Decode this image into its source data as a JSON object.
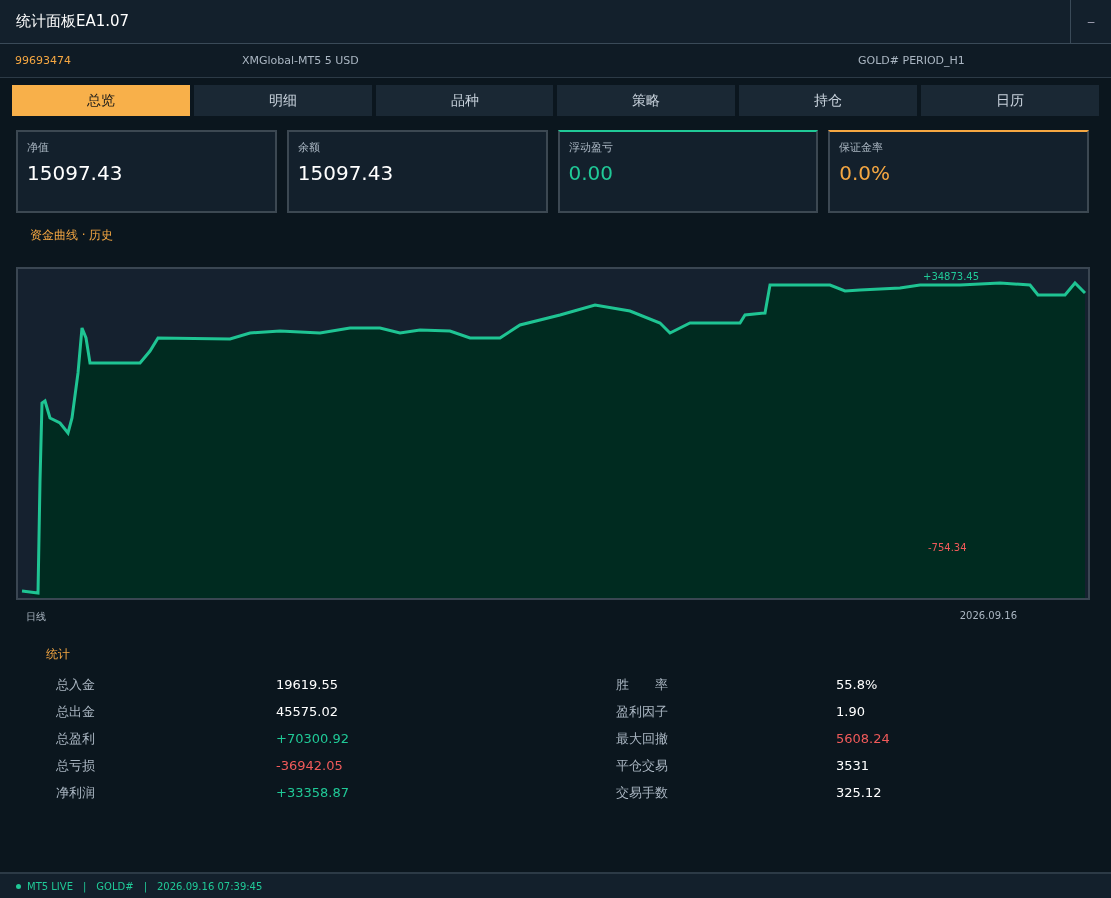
{
  "window": {
    "title": "统计面板EA1.07",
    "minimize": "–"
  },
  "info_bar": {
    "account": "99693474",
    "server": "XMGlobal-MT5 5   USD",
    "symbol": "GOLD#  PERIOD_H1"
  },
  "tabs": [
    {
      "label": "总览",
      "selected": true
    },
    {
      "label": "明细",
      "selected": false
    },
    {
      "label": "品种",
      "selected": false
    },
    {
      "label": "策略",
      "selected": false
    },
    {
      "label": "持仓",
      "selected": false
    },
    {
      "label": "日历",
      "selected": false
    }
  ],
  "cards": [
    {
      "label": "净值",
      "value": "15097.43",
      "color": "#ffffff",
      "accent": false
    },
    {
      "label": "余额",
      "value": "15097.43",
      "color": "#ffffff",
      "accent": false
    },
    {
      "label": "浮动盈亏",
      "value": "0.00",
      "color": "#20c997",
      "accent": true
    },
    {
      "label": "保证金率",
      "value": "0.0%",
      "color": "#f5a742",
      "accent": true
    }
  ],
  "chart": {
    "title": "资金曲线 · 历史",
    "max_label": "+34873.45",
    "min_label": "-754.34",
    "x_start": "日线",
    "x_end": "2026.09.16"
  },
  "stats": {
    "title": "统计",
    "left": [
      {
        "label": "总入金",
        "value": "19619.55",
        "color": "#ffffff"
      },
      {
        "label": "总出金",
        "value": "45575.02",
        "color": "#ffffff"
      },
      {
        "label": "总盈利",
        "value": "+70300.92",
        "color": "#20c997"
      },
      {
        "label": "总亏损",
        "value": "-36942.05",
        "color": "#f05a5a"
      },
      {
        "label": "净利润",
        "value": "+33358.87",
        "color": "#20c997"
      }
    ],
    "right": [
      {
        "label": "胜　　率",
        "value": "55.8%",
        "color": "#ffffff"
      },
      {
        "label": "盈利因子",
        "value": "1.90",
        "color": "#ffffff"
      },
      {
        "label": "最大回撤",
        "value": "5608.24",
        "color": "#f05a5a"
      },
      {
        "label": "平仓交易",
        "value": "3531",
        "color": "#ffffff"
      },
      {
        "label": "交易手数",
        "value": "325.12",
        "color": "#ffffff"
      }
    ]
  },
  "status_bar": {
    "state": "MT5 LIVE",
    "color": "#20c997",
    "symbol": "GOLD#",
    "time": "2026.09.16 07:39:45",
    "separator": "|"
  }
}
